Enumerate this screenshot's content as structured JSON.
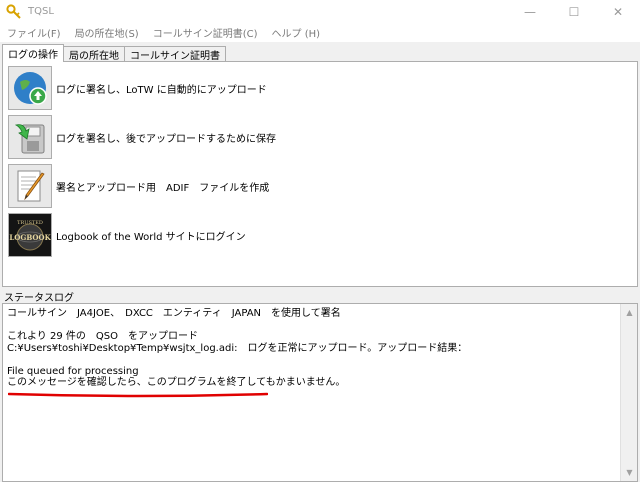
{
  "window": {
    "title": "TQSL",
    "minimize": "—",
    "maximize": "☐",
    "close": "✕"
  },
  "menu": [
    "ファイル(F)",
    "局の所在地(S)",
    "コールサイン証明書(C)",
    "ヘルプ (H)"
  ],
  "tabs": [
    "ログの操作",
    "局の所在地",
    "コールサイン証明書"
  ],
  "actions": [
    {
      "label": "ログに署名し、LoTW に自動的にアップロード",
      "icon": "globe-upload-icon"
    },
    {
      "label": "ログを署名し、後でアップロードするために保存",
      "icon": "save-disk-icon"
    },
    {
      "label": "署名とアップロード用　ADIF　ファイルを作成",
      "icon": "edit-document-icon"
    },
    {
      "label": "Logbook of the World サイトにログイン",
      "icon": "logbook-icon"
    }
  ],
  "status": {
    "header": "ステータスログ",
    "lines": [
      "コールサイン　JA4JOE、　DXCC　エンティティ　JAPAN　を使用して署名",
      "",
      "これより 29 件の　QSO　をアップロード",
      "C:¥Users¥toshi¥Desktop¥Temp¥wsjtx_log.adi:　ログを正常にアップロード。アップロード結果：",
      "",
      "File queued for processing",
      "このメッセージを確認したら、このプログラムを終了してもかまいません。"
    ],
    "underline_color": "#e00000"
  },
  "logo_text": {
    "top": "TRUSTED",
    "main": "LOGBOOK"
  }
}
